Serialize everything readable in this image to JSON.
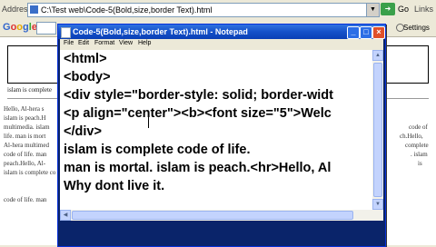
{
  "browser": {
    "address_label": "Address",
    "address_value": "C:\\Test web\\Code-5(Bold,size,border Text).html",
    "go_label": "Go",
    "links_label": "Links",
    "google_logo": {
      "g": "G",
      "o1": "o",
      "o2": "o",
      "g2": "g",
      "l": "l",
      "e": "e"
    },
    "settings_label": "Settings"
  },
  "page": {
    "islam_line": "islam is complete",
    "paragraph_lines": [
      "Hello, Al-hera s",
      "islam is peach.H",
      "multimedia. islam",
      "life. man is mort",
      "Al-hera multimed",
      "code of life. man",
      "peach.Hello, Al-",
      "islam is complete co",
      "",
      "code of life. man"
    ],
    "right_fragments": [
      "code of",
      "ch.Hello,",
      "complete",
      ". islam",
      "is"
    ]
  },
  "notepad": {
    "title": "Code-5(Bold,size,border Text).html - Notepad",
    "menu": [
      "File",
      "Edit",
      "Format",
      "View",
      "Help"
    ],
    "lines": [
      "<html>",
      "<body>",
      "<div style=\"border-style: solid; border-widt",
      "<p align=\"center\"><b><font size=\"5\">Welc",
      "</div>",
      "islam is complete code of life.",
      "man is mortal. islam is peach.<hr>Hello, Al",
      "Why dont live it."
    ]
  },
  "colors": {
    "titlebar": "#1551c9",
    "close_button": "#e0502a",
    "scrollbar": "#c3d3fd"
  }
}
